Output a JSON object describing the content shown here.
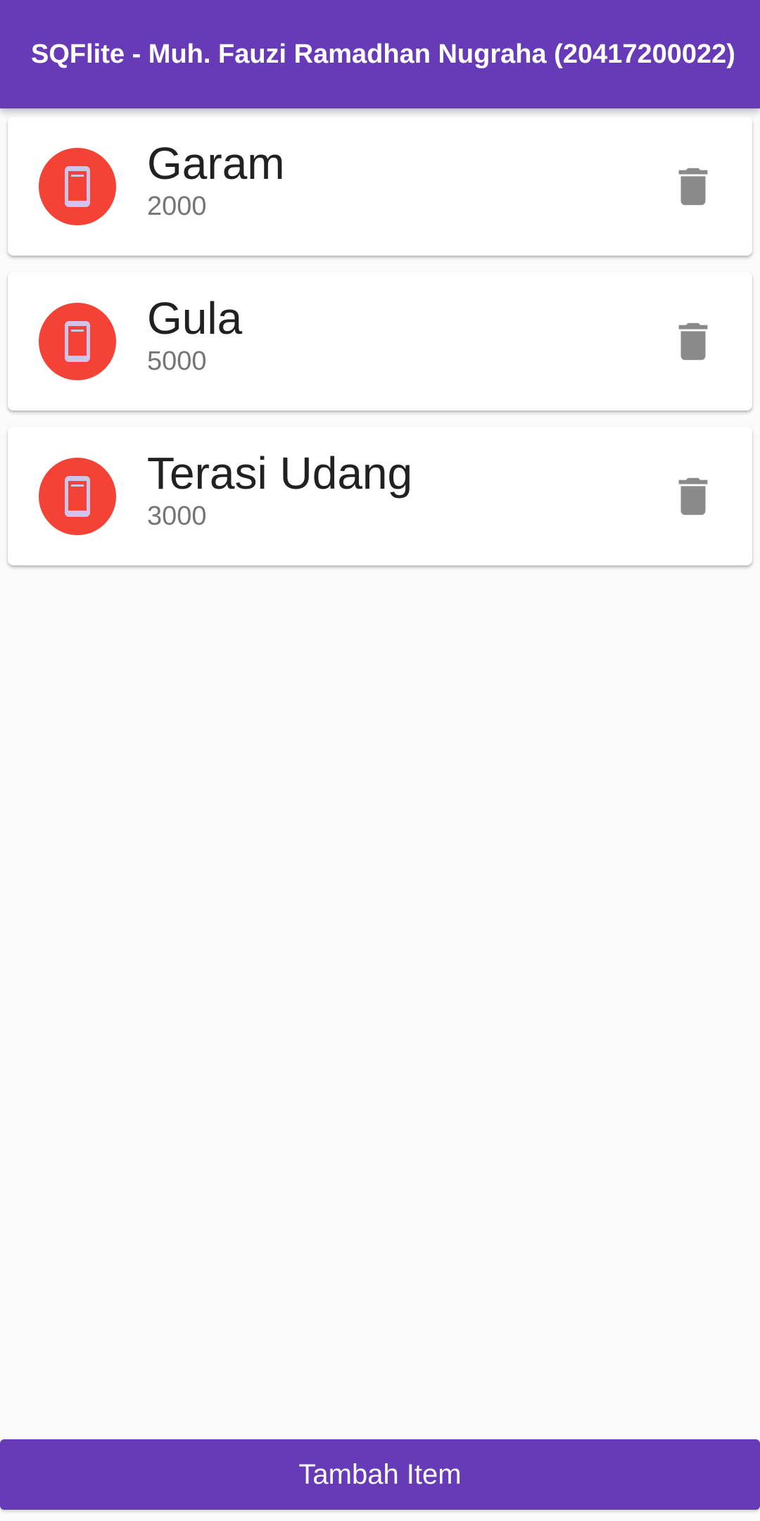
{
  "app_bar": {
    "title": "SQFlite - Muh. Fauzi Ramadhan Nugraha (20417200022)"
  },
  "items": [
    {
      "name": "Garam",
      "price": "2000"
    },
    {
      "name": "Gula",
      "price": "5000"
    },
    {
      "name": "Terasi Udang",
      "price": "3000"
    }
  ],
  "add_button": {
    "label": "Tambah Item"
  },
  "icons": {
    "avatar": "phone-icon",
    "delete": "trash-icon"
  },
  "colors": {
    "primary": "#673ab7",
    "avatar_background": "#f44336",
    "avatar_icon": "#d1c4e9",
    "delete_icon": "#8a8a8a"
  }
}
